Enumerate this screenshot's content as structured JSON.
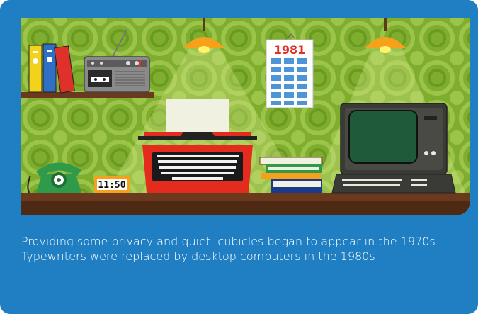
{
  "illustration": {
    "calendar_year": "1981",
    "clock_time": "11:50",
    "colors": {
      "card_background": "#1f7fc2",
      "wallpaper": "#7fae2e",
      "shelf_wood": "#6b3a1e",
      "lamp": "#f5a21a",
      "typewriter": "#e32b1e",
      "phone": "#2e9a4a"
    }
  },
  "caption": {
    "line1": "Providing some privacy and quiet, cubicles began to appear in the 1970s.",
    "line2": "Typewriters were replaced by desktop computers in the 1980s"
  }
}
